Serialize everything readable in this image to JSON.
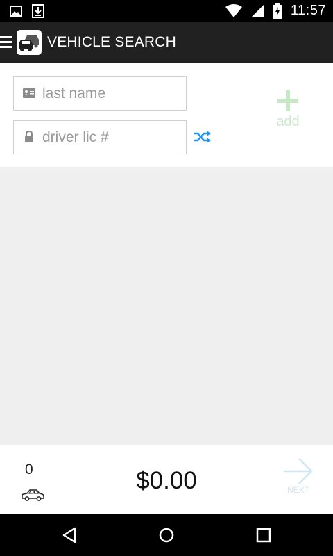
{
  "status_bar": {
    "time": "11:57",
    "icons": [
      "image-icon",
      "download-icon",
      "wifi-icon",
      "signal-icon",
      "battery-icon"
    ]
  },
  "app_bar": {
    "title": "VEHICLE SEARCH",
    "icons": [
      "menu-icon",
      "vehicle-logo-icon"
    ]
  },
  "form": {
    "last_name": {
      "placeholder": "last name",
      "value": ""
    },
    "driver_lic": {
      "placeholder": "driver lic #",
      "value": ""
    },
    "add_label": "add",
    "colors": {
      "shuffle": "#2196f3",
      "add": "#c6e8c6"
    }
  },
  "footer": {
    "vehicle_count": "0",
    "total": "$0.00",
    "next_label": "NEXT"
  },
  "nav_bar": {
    "icons": [
      "back-icon",
      "home-icon",
      "recents-icon"
    ]
  }
}
